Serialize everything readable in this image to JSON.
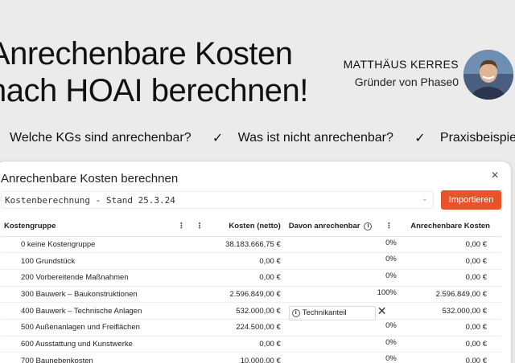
{
  "hero": {
    "title_line1": "Anrechenbare Kosten",
    "title_line2": "nach HOAI berechnen!"
  },
  "author": {
    "name": "MATTHÄUS KERRES",
    "role": "Gründer von Phase0"
  },
  "features": [
    "Welche KGs sind anrechenbar?",
    "Was ist nicht anrechenbar?",
    "Praxisbeispiel"
  ],
  "panel": {
    "title": "Anrechenbare Kosten berechnen",
    "close_icon": "×",
    "select_value": "Kostenberechnung - Stand 25.3.24",
    "import_label": "Importieren"
  },
  "table": {
    "headers": {
      "kostengruppe": "Kostengruppe",
      "kosten": "Kosten (netto)",
      "davon": "Davon anrechenbar",
      "anrechenbar": "Anrechenbare Kosten"
    },
    "rows": [
      {
        "name": "0 keine Kostengruppe",
        "kosten": "38.183.666,75 €",
        "pct": "0%",
        "anrechenbar": "0,00 €"
      },
      {
        "name": "100 Grundstück",
        "kosten": "0,00 €",
        "pct": "0%",
        "anrechenbar": "0,00 €"
      },
      {
        "name": "200 Vorbereitende Maßnahmen",
        "kosten": "0,00 €",
        "pct": "0%",
        "anrechenbar": "0,00 €"
      },
      {
        "name": "300 Bauwerk – Baukonstruktionen",
        "kosten": "2.596.849,00 €",
        "pct": "100%",
        "anrechenbar": "2.596.849,00 €"
      },
      {
        "name": "400 Bauwerk – Technische Anlagen",
        "kosten": "532.000,00 €",
        "pct": "",
        "anrechenbar": "532.000,00 €"
      },
      {
        "name": "500 Außenanlagen und Freiflächen",
        "kosten": "224.500,00 €",
        "pct": "0%",
        "anrechenbar": "0,00 €"
      },
      {
        "name": "600 Ausstattung und Kunstwerke",
        "kosten": "0,00 €",
        "pct": "0%",
        "anrechenbar": "0,00 €"
      },
      {
        "name": "700 Baunebenkosten",
        "kosten": "10.000,00 €",
        "pct": "0%",
        "anrechenbar": "0,00 €"
      }
    ],
    "tag_label": "Technikanteil"
  }
}
